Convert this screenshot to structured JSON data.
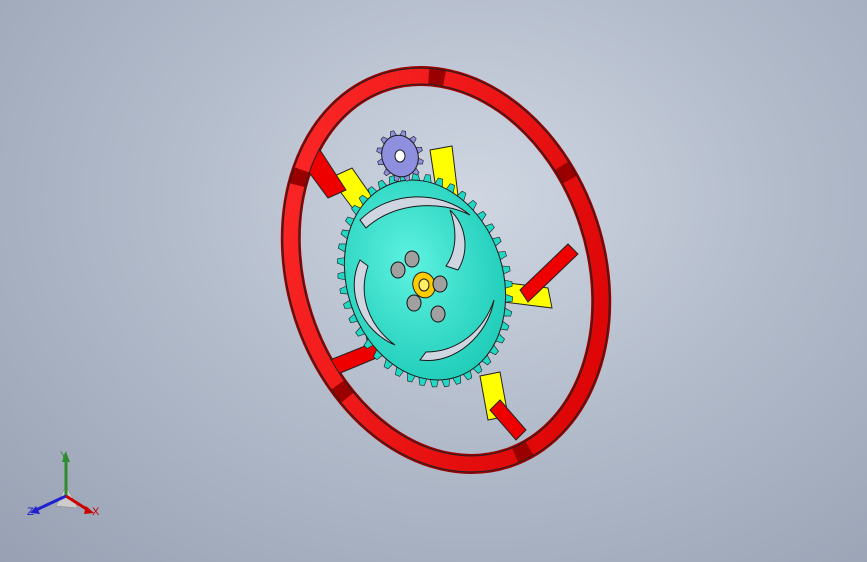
{
  "viewport": {
    "background_top": "#cfd6e2",
    "background_bottom": "#97a1b3"
  },
  "model": {
    "parts": [
      {
        "name": "outer-ring-segments",
        "color": "#ff0000"
      },
      {
        "name": "spokes",
        "color": "#ffff00"
      },
      {
        "name": "large-gear",
        "color": "#20e0cc"
      },
      {
        "name": "pinion-gear",
        "color": "#8f8fe0"
      },
      {
        "name": "center-hub",
        "color": "#ffcc00"
      },
      {
        "name": "pins",
        "color": "#9a9a9a"
      }
    ]
  },
  "triad": {
    "y_label": "Y",
    "z_label": "Z",
    "x_label": "X",
    "y_color": "#2e8b2e",
    "z_color": "#2020cc",
    "x_color": "#cc0000"
  }
}
